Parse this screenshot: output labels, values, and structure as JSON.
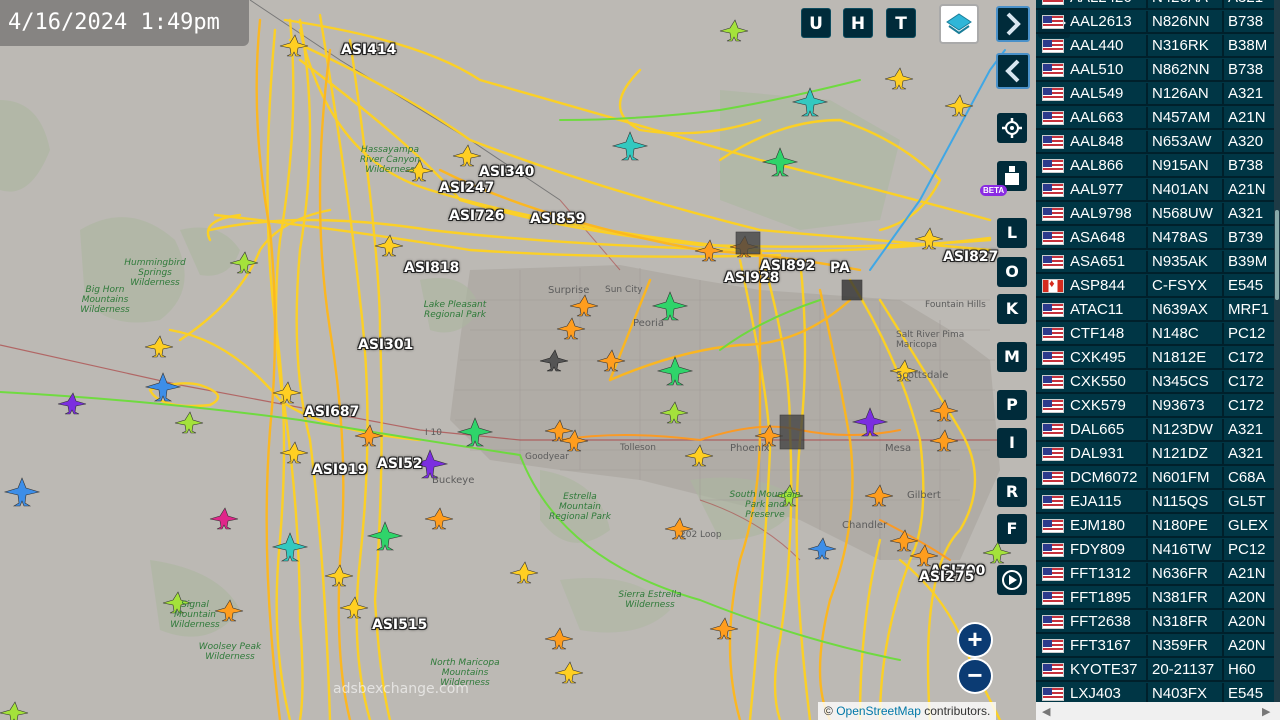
{
  "timestamp": "4/16/2024 1:49pm",
  "top_buttons": {
    "u": "U",
    "h": "H",
    "t": "T"
  },
  "side_buttons": [
    "L",
    "O",
    "K",
    "M",
    "P",
    "I",
    "R",
    "F"
  ],
  "beta_badge": "BETA",
  "zoom": {
    "in": "+",
    "out": "−"
  },
  "watermark": "adsbexchange.com",
  "attribution": {
    "prefix": "©",
    "link": "OpenStreetMap",
    "suffix": "contributors."
  },
  "map_labels": {
    "surprise": "Surprise",
    "sun_city": "Sun City",
    "peoria": "Peoria",
    "scottsdale": "Scottsdale",
    "tolleson": "Tolleson",
    "phoenix": "Phoenix",
    "gilbert": "Gilbert",
    "mesa": "Mesa",
    "fountain_hills": "Fountain Hills",
    "salt_river": "Salt River Pima Maricopa",
    "loop_202": "202 Loop",
    "goodyear": "Goodyear",
    "buckeye": "Buckeye",
    "chandler": "Chandler",
    "i10": "I 10"
  },
  "park_labels": {
    "hummingbird": "Hummingbird Springs Wilderness",
    "big_horn": "Big Horn Mountains Wilderness",
    "hassayampa": "Hassayampa River Canyon Wilderness",
    "lake_pleasant": "Lake Pleasant Regional Park",
    "estrella": "Estrella Mountain Regional Park",
    "south_mountain": "South Mountain Park and Preserve",
    "sierra_estrella": "Sierra Estrella Wilderness",
    "signal": "Signal Mountain Wilderness",
    "woolsey": "Woolsey Peak Wilderness",
    "north_maricopa": "North Maricopa Mountains Wilderness"
  },
  "aircraft_labels": [
    "ASI414",
    "ASI340",
    "ASI247",
    "ASI726",
    "ASI859",
    "ASI818",
    "ASI892",
    "ASI928",
    "PA",
    "ASI827",
    "ASI301",
    "ASI687",
    "ASI919",
    "ASI52",
    "ASI515",
    "ASI700",
    "ASI275"
  ],
  "table": {
    "rows": [
      {
        "flag": "us",
        "callsign": "AAL2426",
        "reg": "N426AA",
        "type": "A321"
      },
      {
        "flag": "us",
        "callsign": "AAL2613",
        "reg": "N826NN",
        "type": "B738"
      },
      {
        "flag": "us",
        "callsign": "AAL440",
        "reg": "N316RK",
        "type": "B38M"
      },
      {
        "flag": "us",
        "callsign": "AAL510",
        "reg": "N862NN",
        "type": "B738"
      },
      {
        "flag": "us",
        "callsign": "AAL549",
        "reg": "N126AN",
        "type": "A321"
      },
      {
        "flag": "us",
        "callsign": "AAL663",
        "reg": "N457AM",
        "type": "A21N"
      },
      {
        "flag": "us",
        "callsign": "AAL848",
        "reg": "N653AW",
        "type": "A320"
      },
      {
        "flag": "us",
        "callsign": "AAL866",
        "reg": "N915AN",
        "type": "B738"
      },
      {
        "flag": "us",
        "callsign": "AAL977",
        "reg": "N401AN",
        "type": "A21N"
      },
      {
        "flag": "us",
        "callsign": "AAL9798",
        "reg": "N568UW",
        "type": "A321"
      },
      {
        "flag": "us",
        "callsign": "ASA648",
        "reg": "N478AS",
        "type": "B739"
      },
      {
        "flag": "us",
        "callsign": "ASA651",
        "reg": "N935AK",
        "type": "B39M"
      },
      {
        "flag": "ca",
        "callsign": "ASP844",
        "reg": "C-FSYX",
        "type": "E545"
      },
      {
        "flag": "us",
        "callsign": "ATAC11",
        "reg": "N639AX",
        "type": "MRF1"
      },
      {
        "flag": "us",
        "callsign": "CTF148",
        "reg": "N148C",
        "type": "PC12"
      },
      {
        "flag": "us",
        "callsign": "CXK495",
        "reg": "N1812E",
        "type": "C172"
      },
      {
        "flag": "us",
        "callsign": "CXK550",
        "reg": "N345CS",
        "type": "C172"
      },
      {
        "flag": "us",
        "callsign": "CXK579",
        "reg": "N93673",
        "type": "C172"
      },
      {
        "flag": "us",
        "callsign": "DAL665",
        "reg": "N123DW",
        "type": "A321"
      },
      {
        "flag": "us",
        "callsign": "DAL931",
        "reg": "N121DZ",
        "type": "A321"
      },
      {
        "flag": "us",
        "callsign": "DCM6072",
        "reg": "N601FM",
        "type": "C68A"
      },
      {
        "flag": "us",
        "callsign": "EJA115",
        "reg": "N115QS",
        "type": "GL5T"
      },
      {
        "flag": "us",
        "callsign": "EJM180",
        "reg": "N180PE",
        "type": "GLEX"
      },
      {
        "flag": "us",
        "callsign": "FDY809",
        "reg": "N416TW",
        "type": "PC12"
      },
      {
        "flag": "us",
        "callsign": "FFT1312",
        "reg": "N636FR",
        "type": "A21N"
      },
      {
        "flag": "us",
        "callsign": "FFT1895",
        "reg": "N381FR",
        "type": "A20N"
      },
      {
        "flag": "us",
        "callsign": "FFT2638",
        "reg": "N318FR",
        "type": "A20N"
      },
      {
        "flag": "us",
        "callsign": "FFT3167",
        "reg": "N359FR",
        "type": "A20N"
      },
      {
        "flag": "us",
        "callsign": "KYOTE37",
        "reg": "20-21137",
        "type": "H60"
      },
      {
        "flag": "us",
        "callsign": "LXJ403",
        "reg": "N403FX",
        "type": "E545"
      }
    ]
  }
}
